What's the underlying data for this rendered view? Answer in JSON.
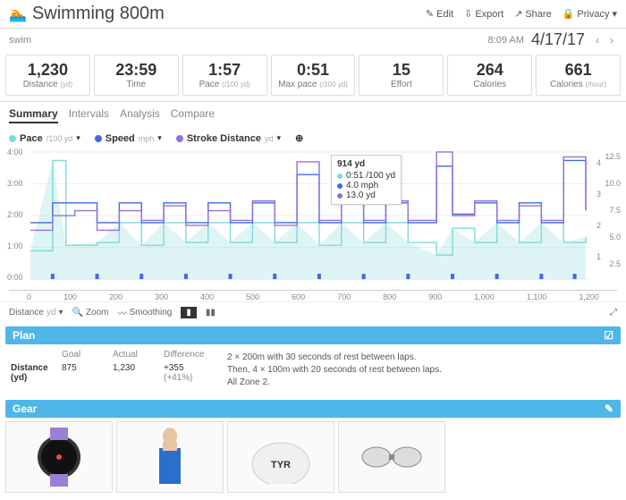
{
  "header": {
    "title": "Swimming 800m",
    "edit": "Edit",
    "export": "Export",
    "share": "Share",
    "privacy": "Privacy"
  },
  "subheader": {
    "type": "swim",
    "time": "8:09 AM",
    "date": "4/17/17"
  },
  "stats": [
    {
      "val": "1,230",
      "lbl": "Distance",
      "sub": "(yd)"
    },
    {
      "val": "23:59",
      "lbl": "Time",
      "sub": ""
    },
    {
      "val": "1:57",
      "lbl": "Pace",
      "sub": "(/100 yd)"
    },
    {
      "val": "0:51",
      "lbl": "Max pace",
      "sub": "(/100 yd)"
    },
    {
      "val": "15",
      "lbl": "Effort",
      "sub": ""
    },
    {
      "val": "264",
      "lbl": "Calories",
      "sub": ""
    },
    {
      "val": "661",
      "lbl": "Calories",
      "sub": "(/hour)"
    }
  ],
  "tabs": [
    "Summary",
    "Intervals",
    "Analysis",
    "Compare"
  ],
  "metrics": [
    {
      "name": "Pace",
      "unit": "/100 yd",
      "color": "#7fd9d9"
    },
    {
      "name": "Speed",
      "unit": "mph",
      "color": "#4169e1"
    },
    {
      "name": "Stroke Distance",
      "unit": "yd",
      "color": "#9370db"
    }
  ],
  "tooltip": {
    "header": "914 yd",
    "rows": [
      {
        "color": "#7fd9d9",
        "text": "0:51 /100 yd"
      },
      {
        "color": "#4169e1",
        "text": "4.0 mph"
      },
      {
        "color": "#9370db",
        "text": "13.0 yd"
      }
    ]
  },
  "yaxis_left": [
    "4:00",
    "3:00",
    "2:00",
    "1:00",
    "0:00"
  ],
  "yaxis_right_a": [
    "4",
    "3",
    "2",
    "1"
  ],
  "yaxis_right_b": [
    "12.5",
    "10.0",
    "7.5",
    "5.0",
    "2.5"
  ],
  "xaxis": [
    "0",
    "100",
    "200",
    "300",
    "400",
    "500",
    "600",
    "700",
    "800",
    "900",
    "1,000",
    "1,100",
    "1,200"
  ],
  "controls": {
    "distance": "Distance",
    "distance_unit": "yd",
    "zoom": "Zoom",
    "smoothing": "Smoothing"
  },
  "plan": {
    "title": "Plan",
    "cols": [
      "Goal",
      "Actual",
      "Difference"
    ],
    "row_label": "Distance (yd)",
    "goal": "875",
    "actual": "1,230",
    "diff": "+355",
    "pct": "(+41%)",
    "text1": "2 × 200m with 30 seconds of rest between laps.",
    "text2": "Then, 4 × 100m with 20 seconds of rest between laps.",
    "text3": "All Zone 2."
  },
  "gear": {
    "title": "Gear"
  },
  "chart_data": {
    "type": "line",
    "x_range": [
      0,
      1260
    ],
    "series": [
      {
        "name": "Pace",
        "unit": "/100 yd",
        "color": "#7fd9d9",
        "y_range": [
          0,
          4.5
        ],
        "points": [
          [
            0,
            1.0
          ],
          [
            50,
            4.2
          ],
          [
            80,
            1.2
          ],
          [
            150,
            1.3
          ],
          [
            200,
            2.0
          ],
          [
            250,
            1.2
          ],
          [
            300,
            2.0
          ],
          [
            350,
            1.3
          ],
          [
            400,
            2.0
          ],
          [
            450,
            1.3
          ],
          [
            500,
            2.0
          ],
          [
            550,
            1.3
          ],
          [
            600,
            2.0
          ],
          [
            650,
            1.2
          ],
          [
            700,
            2.0
          ],
          [
            750,
            1.3
          ],
          [
            800,
            2.0
          ],
          [
            850,
            1.3
          ],
          [
            914,
            0.85
          ],
          [
            950,
            1.8
          ],
          [
            1000,
            1.3
          ],
          [
            1050,
            2.0
          ],
          [
            1100,
            1.3
          ],
          [
            1150,
            2.0
          ],
          [
            1200,
            1.3
          ],
          [
            1250,
            1.5
          ]
        ]
      },
      {
        "name": "Speed",
        "unit": "mph",
        "color": "#4169e1",
        "y_range": [
          0,
          4.5
        ],
        "points": [
          [
            0,
            2.0
          ],
          [
            50,
            2.7
          ],
          [
            100,
            2.7
          ],
          [
            150,
            2.0
          ],
          [
            200,
            2.7
          ],
          [
            250,
            2.0
          ],
          [
            300,
            2.7
          ],
          [
            350,
            2.0
          ],
          [
            400,
            2.7
          ],
          [
            450,
            2.0
          ],
          [
            500,
            2.7
          ],
          [
            550,
            2.0
          ],
          [
            600,
            3.7
          ],
          [
            650,
            2.0
          ],
          [
            700,
            3.0
          ],
          [
            750,
            2.0
          ],
          [
            800,
            2.7
          ],
          [
            850,
            2.0
          ],
          [
            914,
            4.0
          ],
          [
            950,
            2.3
          ],
          [
            1000,
            2.7
          ],
          [
            1050,
            2.0
          ],
          [
            1100,
            2.7
          ],
          [
            1150,
            2.0
          ],
          [
            1200,
            4.2
          ],
          [
            1250,
            2.5
          ]
        ]
      },
      {
        "name": "Stroke Distance",
        "unit": "yd",
        "color": "#9370db",
        "y_range": [
          0,
          13
        ],
        "points": [
          [
            0,
            5.0
          ],
          [
            50,
            6.5
          ],
          [
            100,
            7.0
          ],
          [
            150,
            5.0
          ],
          [
            200,
            7.0
          ],
          [
            250,
            6.0
          ],
          [
            300,
            7.5
          ],
          [
            350,
            5.5
          ],
          [
            400,
            7.0
          ],
          [
            450,
            6.0
          ],
          [
            500,
            8.0
          ],
          [
            550,
            5.5
          ],
          [
            600,
            12.0
          ],
          [
            650,
            6.0
          ],
          [
            700,
            8.0
          ],
          [
            750,
            6.0
          ],
          [
            800,
            8.0
          ],
          [
            850,
            6.0
          ],
          [
            914,
            13.0
          ],
          [
            950,
            6.5
          ],
          [
            1000,
            8.0
          ],
          [
            1050,
            6.0
          ],
          [
            1100,
            7.5
          ],
          [
            1150,
            6.0
          ],
          [
            1200,
            12.5
          ],
          [
            1250,
            7.0
          ]
        ]
      }
    ],
    "markers_x": [
      50,
      150,
      250,
      350,
      450,
      550,
      650,
      750,
      850,
      950,
      1050,
      1150,
      1225
    ]
  }
}
